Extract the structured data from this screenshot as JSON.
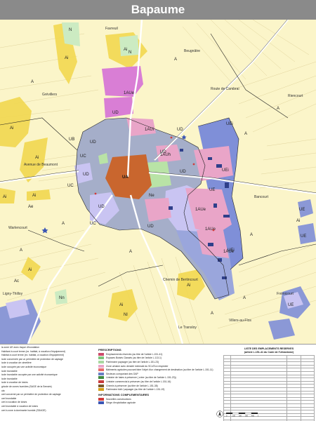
{
  "title": "Bapaume",
  "map": {
    "zone_labels": [
      "N",
      "N",
      "A",
      "A",
      "A",
      "A",
      "A",
      "A",
      "A",
      "A",
      "A",
      "A",
      "Ai",
      "Ai",
      "Ai",
      "Ai",
      "Ai",
      "Ai",
      "Ai",
      "Ai",
      "Ai",
      "UD",
      "UD",
      "UD",
      "UD",
      "UD",
      "UD",
      "UD",
      "UD",
      "UEi",
      "UEi",
      "UEi",
      "UE",
      "UE",
      "UE",
      "UE",
      "UB",
      "UC",
      "UC",
      "UC",
      "1AUe",
      "1AUe",
      "1AUe",
      "1AUe",
      "1AUi",
      "1AUh",
      "Ac",
      "Ae",
      "Ne",
      "Nn",
      "Nl",
      "Ai",
      "UA"
    ],
    "place_labels": [
      "Avenue de Beaumont",
      "Frémicourt",
      "Beugnâtre",
      "Bancourt",
      "Riencourt",
      "Villers-au-Flos",
      "Le Transloy",
      "Ligny-Thilloy",
      "Warlencourt",
      "Grévillers",
      "Favreuil",
      "Chemin de Bertincourt",
      "Route de Cambrai"
    ]
  },
  "legend": {
    "zones": [
      "la zone UE avec risque d'inondation",
      "Habitant à court terme (ex. habitat, à vocation d'équipement)",
      "Habitat à court terme (ex. habitat, à vocation d'équipement)",
      "icole concernée par un périmètre de protection de captage",
      "icole à vocation de cimetière",
      "icole occupée par une activité économique",
      "icole inondable",
      "icole inondable occupée par une activité économique",
      "icole inondable",
      "icole à vocation de loisirs",
      "gricole de zones humides (SAGE de la Sensée)",
      "ula",
      "urel concerné par un périmètre de protection de captage",
      "urel inondable",
      "urel à vocation de loisirs",
      "urel inondable à vocation de loisirs",
      "urel à zone à dominante humide (SDAGE)"
    ],
    "prescriptions_title": "PRESCRIPTIONS",
    "prescriptions": [
      {
        "label": "Emplacements réservés (au titre de l'article L.151-41)",
        "color": "#cc4a6a"
      },
      {
        "label": "Espaces Boisés Classés (au titre de l'article L.113-1)",
        "color": "#7cc47a"
      },
      {
        "label": "Patrimoine paysager (au titre de l'article L.151-23)",
        "color": "#a8d8a0"
      },
      {
        "label": "Zone urbaine avec densité minimale du SCoTA à respecter",
        "color": "#e9a5c8"
      },
      {
        "label": "Bâtiments agricoles pouvant faire l'objet d'un changement de destination (au titre de l'article L.151-11)",
        "color": "#e86b6b"
      },
      {
        "label": "Secteurs comportant des OAP",
        "color": "#6a7fc4"
      },
      {
        "label": "Linéaire de haies à préserver ( créer (au titre de l'article L.151-23))",
        "color": "#3f8a3f"
      },
      {
        "label": "Linéaire commercial à préserver (au titre de l'article L.151-16)",
        "color": "#c83c3c"
      },
      {
        "label": "Chemin à préserver (au titre de l'article L.151-38)",
        "color": "#7a5a2a"
      },
      {
        "label": "Patrimoine bâti / paysager (au titre de l'article L.151-19)",
        "color": "#d4a017"
      }
    ],
    "info_title": "INFORMATIONS COMPLEMENTAIRES",
    "info": [
      {
        "label": "Nouvelles constructions",
        "color": "#d23b3b"
      },
      {
        "label": "Siège d'exploitation agricole",
        "color": "#3a55b4"
      }
    ]
  },
  "table": {
    "title": "LISTE DES EMPLACEMENTS RESERVES",
    "subtitle": "(article L.151-41 du Code de l'Urbanisme)",
    "row_count": 21
  },
  "scale": {
    "ticks": [
      "0",
      "100",
      "200",
      "300",
      "400",
      "500 m"
    ]
  },
  "colors": {
    "agricultural": "#fbf5c9",
    "flood_zone": "#f2d850",
    "urban_dense": "#a5aec9",
    "urban_blue": "#7f8fd8",
    "economic": "#c9c4f2",
    "future_urban": "#e9a5c8",
    "future_magenta": "#d97ed5",
    "natural": "#ccebc2",
    "historic_core": "#c9662e",
    "roads": "#ffffff",
    "parcel_lines": "#c9b97c"
  }
}
